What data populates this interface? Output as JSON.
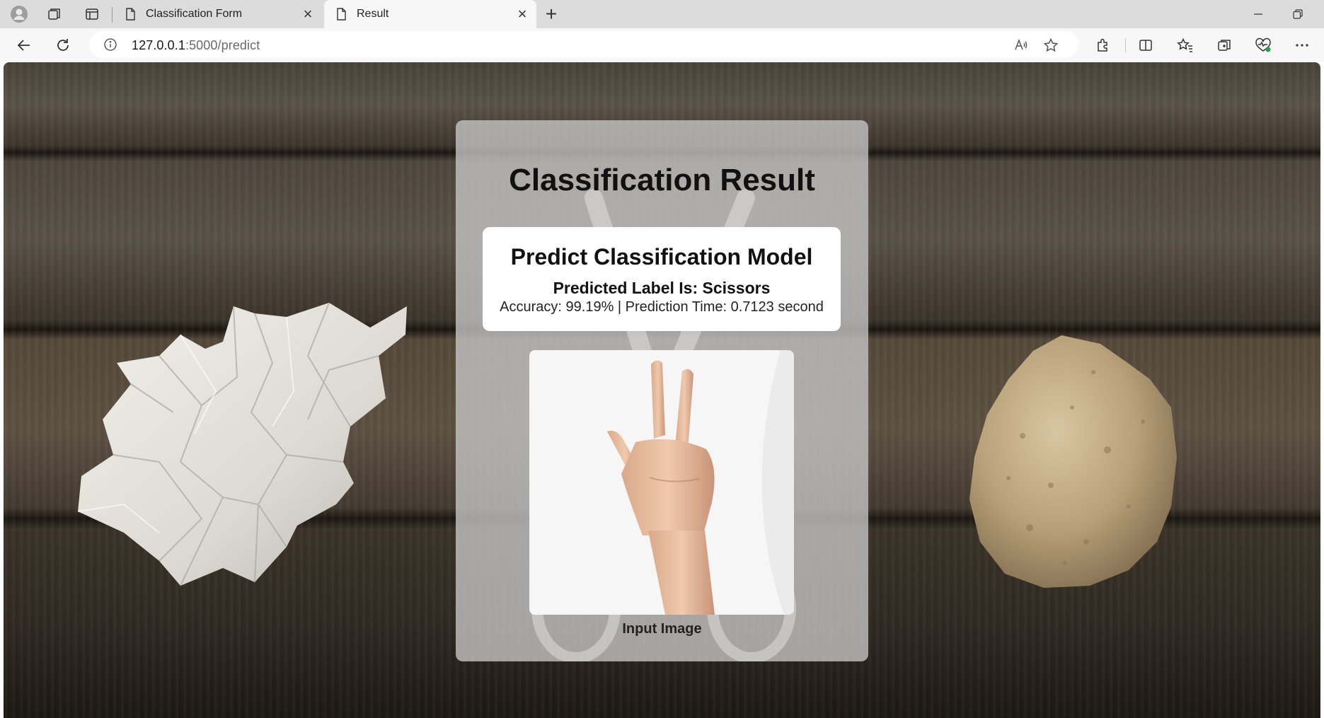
{
  "browser": {
    "tabs": [
      {
        "title": "Classification Form",
        "active": false
      },
      {
        "title": "Result",
        "active": true
      }
    ],
    "address": {
      "host": "127.0.0.1",
      "path": ":5000/predict"
    }
  },
  "page": {
    "heading": "Classification Result",
    "model_title": "Predict Classification Model",
    "predicted_label": "Predicted Label Is: Scissors",
    "stats": "Accuracy: 99.19% | Prediction Time: 0.7123 second",
    "image_caption": "Input Image"
  },
  "theme": {
    "card_background": "#c4c4c4",
    "result_box_background": "#ffffff",
    "active_tab": "#f7f7f7",
    "tab_strip": "#dcdcdc"
  }
}
